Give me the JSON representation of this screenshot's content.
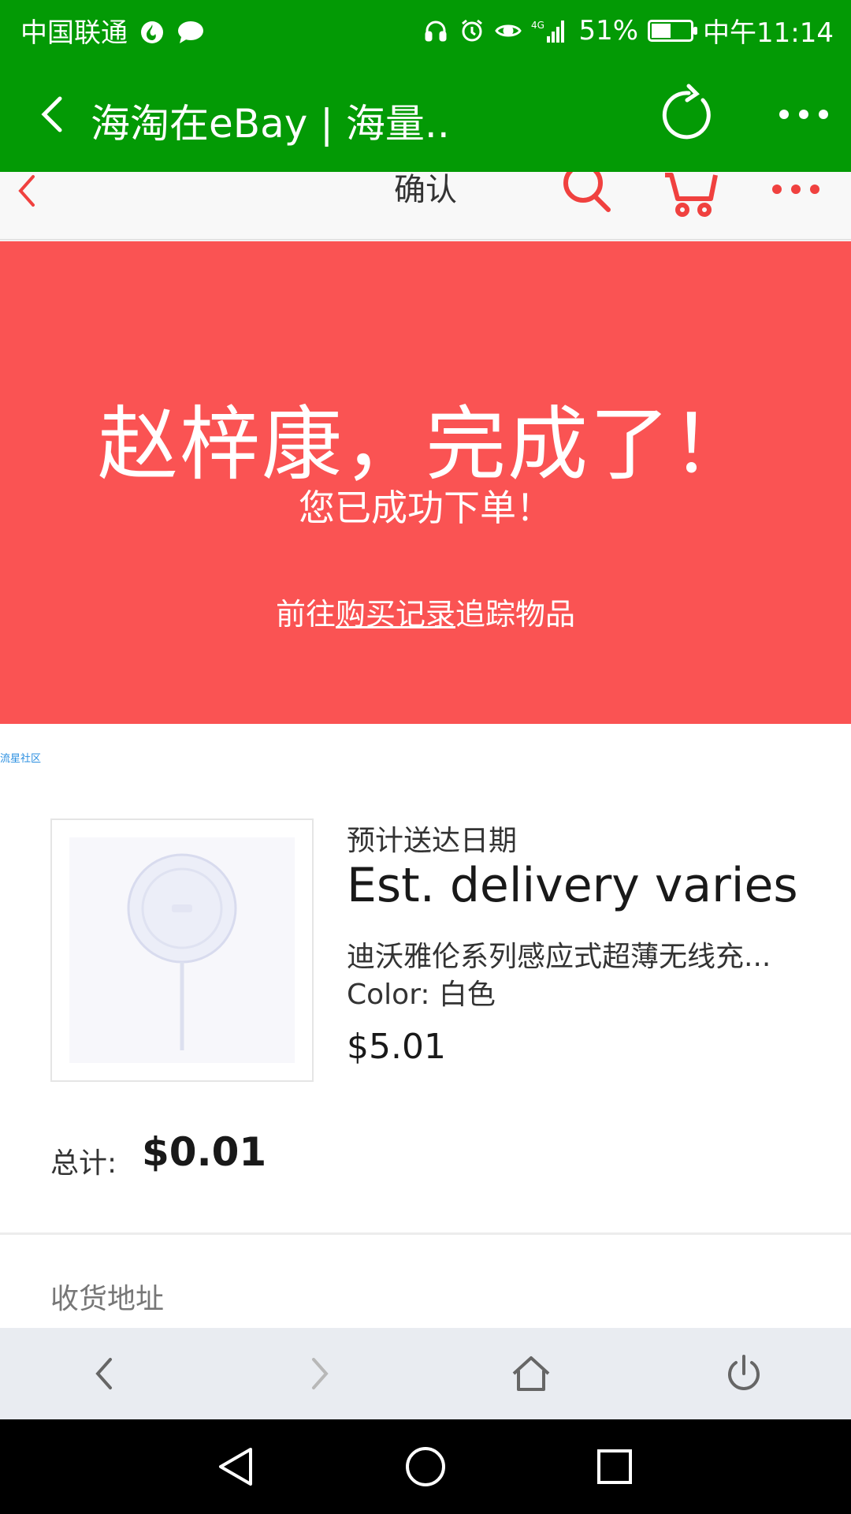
{
  "status_bar": {
    "carrier": "中国联通",
    "network": "4G",
    "battery": "51%",
    "battery_level": 0.51,
    "time": "中午11:14"
  },
  "app_bar": {
    "title": "海淘在eBay | 海量.."
  },
  "page_header": {
    "title": "确认"
  },
  "banner": {
    "headline": "赵梓康，完成了！",
    "subtitle": "您已成功下单！",
    "link_prefix": "前往",
    "link_text": "购买记录",
    "link_suffix": "追踪物品",
    "color": "#fa5353"
  },
  "community_label": "流星社区",
  "item": {
    "est_label": "预计送达日期",
    "est_value": "Est. delivery varies",
    "title": "迪沃雅伦系列感应式超薄无线充...",
    "color": "Color: 白色",
    "price": "$5.01"
  },
  "total": {
    "label": "总计:",
    "value": "$0.01"
  },
  "shipping": {
    "label": "收货地址"
  },
  "colors": {
    "wechat_green": "#039a05",
    "accent_red": "#fa5353",
    "toolbar_bg": "#e9ecf1"
  }
}
